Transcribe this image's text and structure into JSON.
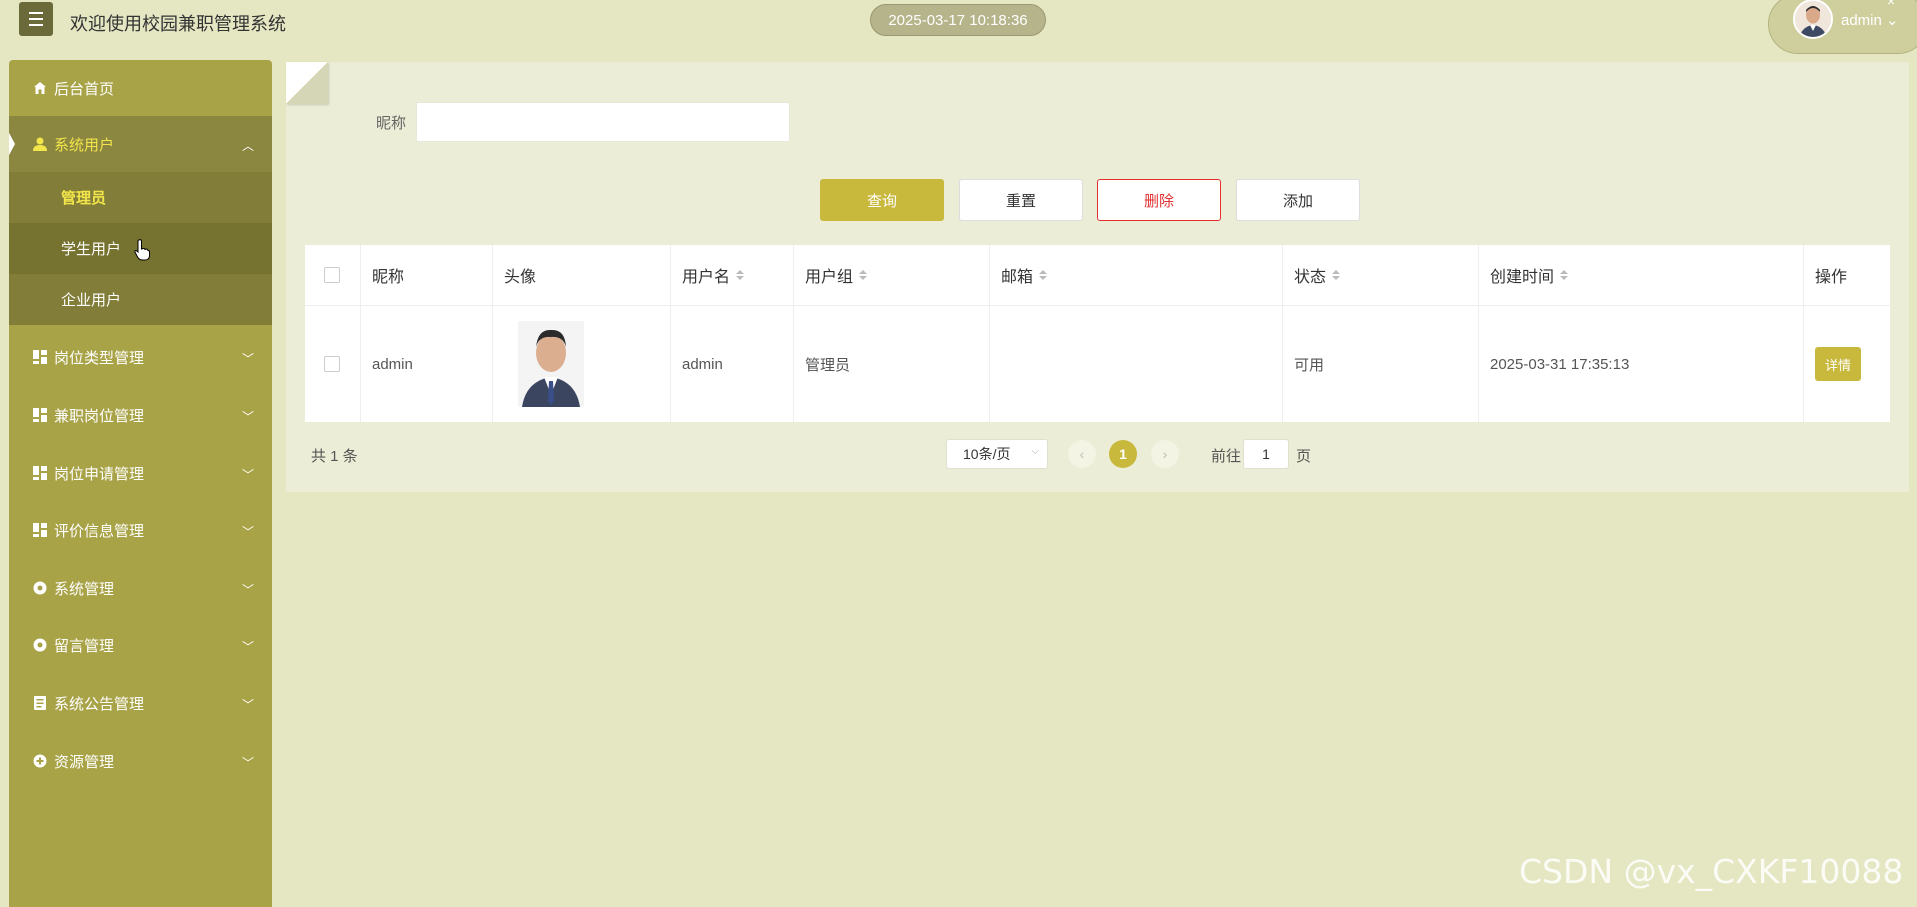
{
  "header": {
    "title": "欢迎使用校园兼职管理系统",
    "datetime": "2025-03-17 10:18:36",
    "user": "admin",
    "user_caret": "⌄",
    "close": "×"
  },
  "sidebar": {
    "items": [
      {
        "label": "后台首页",
        "icon": "home-icon"
      },
      {
        "label": "系统用户",
        "icon": "user-icon",
        "active": true
      },
      {
        "label": "岗位类型管理",
        "icon": "grid-icon"
      },
      {
        "label": "兼职岗位管理",
        "icon": "grid-icon"
      },
      {
        "label": "岗位申请管理",
        "icon": "grid-icon"
      },
      {
        "label": "评价信息管理",
        "icon": "grid-icon"
      },
      {
        "label": "系统管理",
        "icon": "gear-icon"
      },
      {
        "label": "留言管理",
        "icon": "gear-icon"
      },
      {
        "label": "系统公告管理",
        "icon": "document-icon"
      },
      {
        "label": "资源管理",
        "icon": "plus-circle-icon"
      }
    ],
    "sub_items": [
      {
        "label": "管理员",
        "current": true
      },
      {
        "label": "学生用户"
      },
      {
        "label": "企业用户"
      }
    ]
  },
  "search": {
    "label": "昵称",
    "value": "",
    "placeholder": ""
  },
  "actions": {
    "query": "查询",
    "reset": "重置",
    "delete": "删除",
    "add": "添加"
  },
  "table": {
    "columns": [
      "昵称",
      "头像",
      "用户名",
      "用户组",
      "邮箱",
      "状态",
      "创建时间",
      "操作"
    ],
    "rows": [
      {
        "nickname": "admin",
        "username": "admin",
        "group": "管理员",
        "email": "",
        "status": "可用",
        "created": "2025-03-31 17:35:13",
        "action": "详情"
      }
    ]
  },
  "pagination": {
    "total_text": "共 1 条",
    "page_size": "10条/页",
    "current_page": "1",
    "prev": "‹",
    "next": "›",
    "goto_label": "前往",
    "goto_value": "1",
    "goto_suffix": "页"
  },
  "watermark": "CSDN @vx_CXKF10088",
  "colors": {
    "accent": "#c8b83c",
    "sidebar": "#a9a348",
    "background": "#e5e6c2",
    "danger": "#e23030"
  }
}
